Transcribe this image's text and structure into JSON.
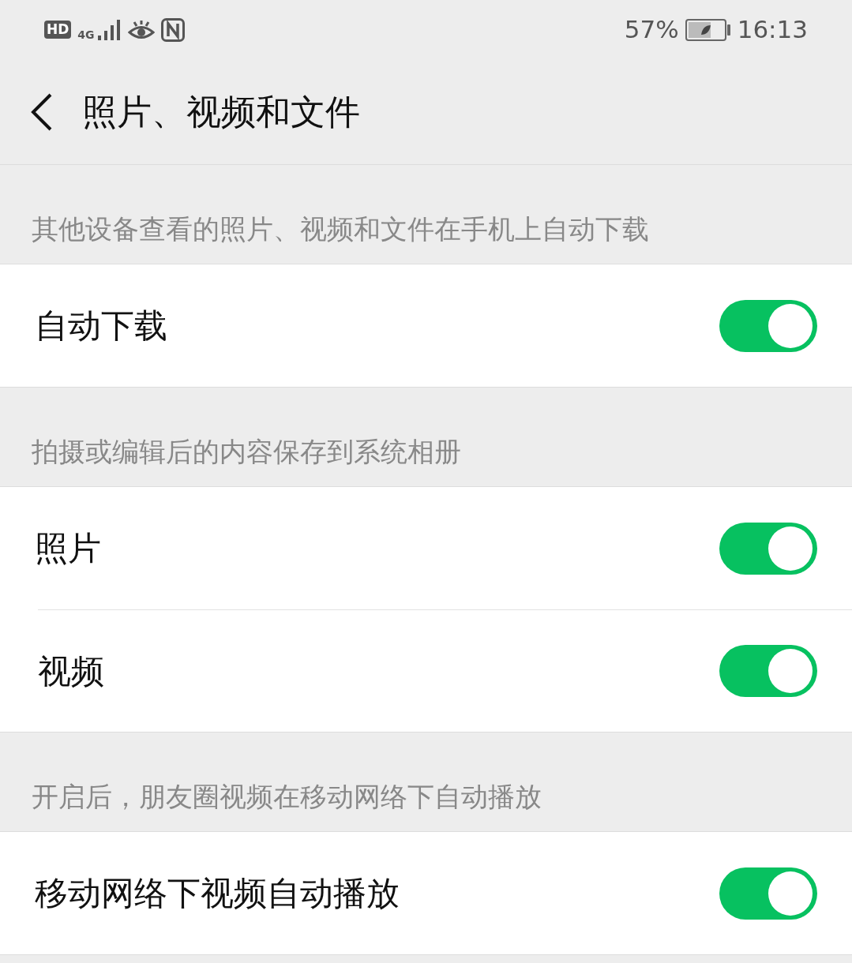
{
  "status_bar": {
    "network_badges": [
      "HD",
      "4G"
    ],
    "battery_percent": "57%",
    "time": "16:13"
  },
  "header": {
    "title": "照片、视频和文件"
  },
  "sections": [
    {
      "caption": "其他设备查看的照片、视频和文件在手机上自动下载",
      "items": [
        {
          "label": "自动下载",
          "on": true
        }
      ]
    },
    {
      "caption": "拍摄或编辑后的内容保存到系统相册",
      "items": [
        {
          "label": "照片",
          "on": true
        },
        {
          "label": "视频",
          "on": true
        }
      ]
    },
    {
      "caption": "开启后，朋友圈视频在移动网络下自动播放",
      "items": [
        {
          "label": "移动网络下视频自动播放",
          "on": true
        }
      ]
    }
  ]
}
